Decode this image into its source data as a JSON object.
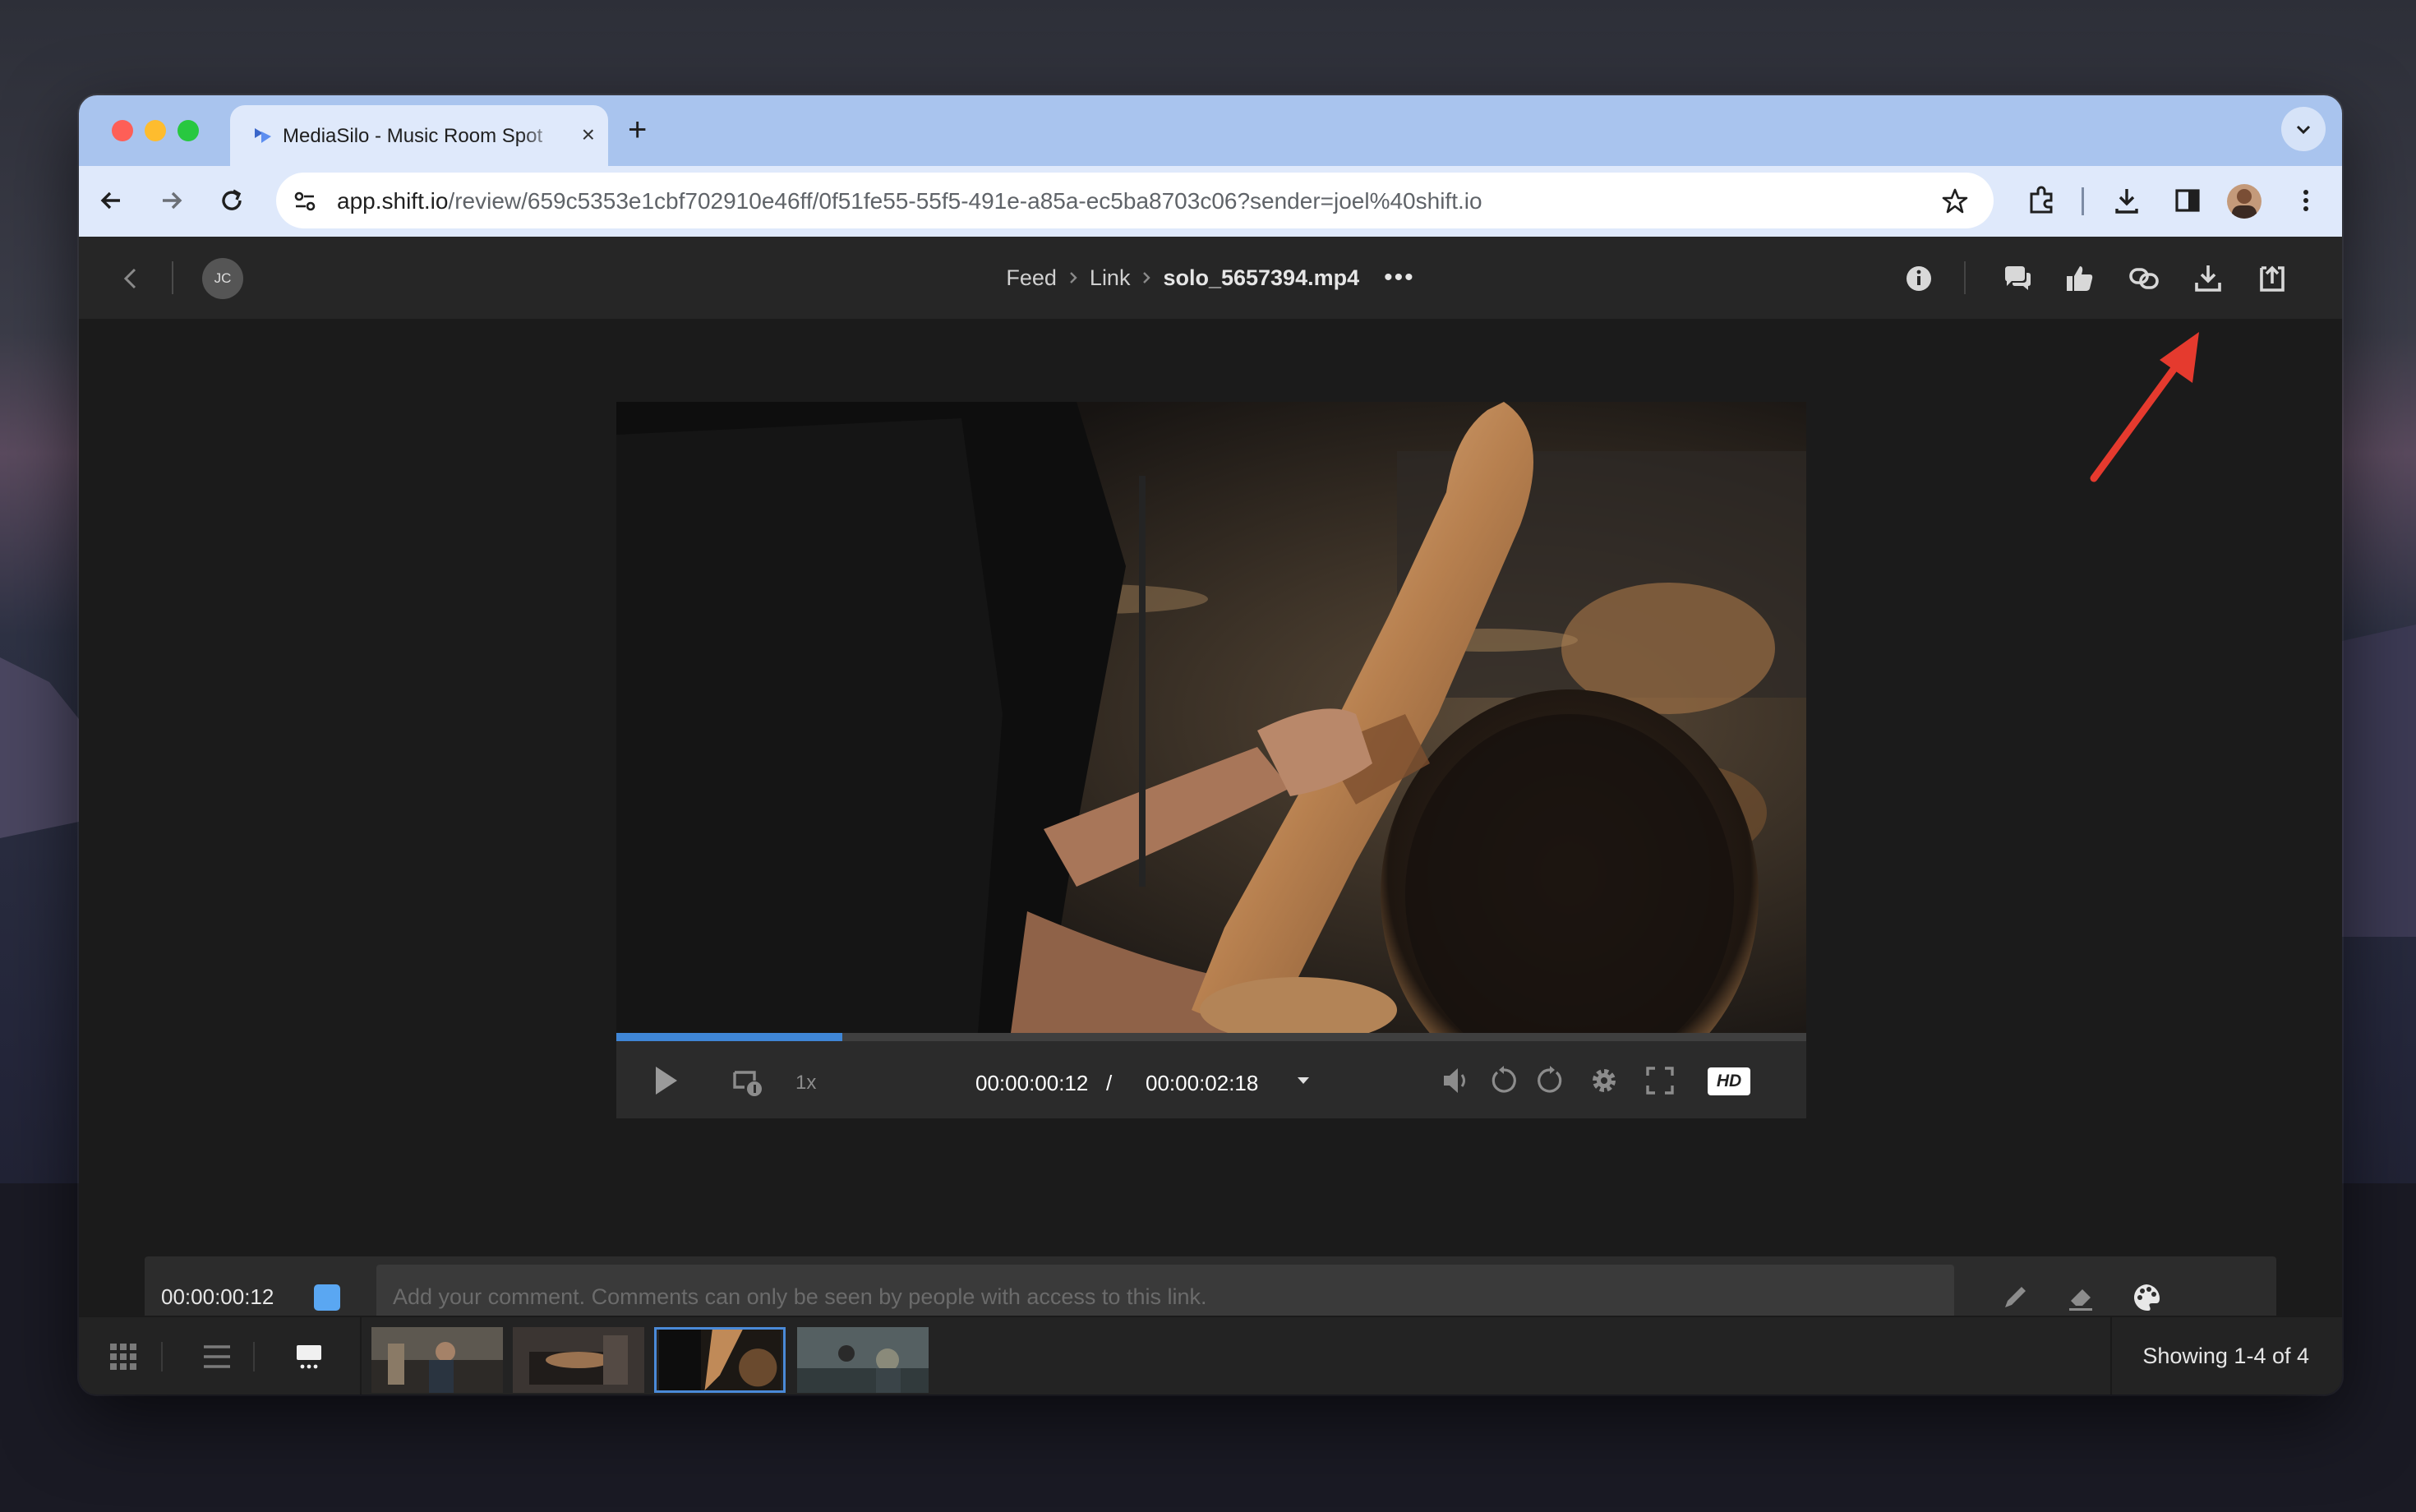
{
  "browser": {
    "tab_title": "MediaSilo - Music Room Spot",
    "new_tab": "+",
    "tab_close": "×",
    "url_domain": "app.shift.io",
    "url_path": "/review/659c5353e1cbf702910e46ff/0f51fe55-55f5-491e-a85a-ec5ba8703c06?sender=joel%40shift.io"
  },
  "header": {
    "avatar_initials": "JC",
    "breadcrumb": [
      "Feed",
      "Link",
      "solo_5657394.mp4"
    ],
    "more": "•••"
  },
  "player": {
    "progress": 0.19,
    "speed": "1x",
    "current_time": "00:00:00:12",
    "separator": "/",
    "duration": "00:00:02:18",
    "quality_badge": "HD"
  },
  "comment": {
    "timestamp": "00:00:00:12",
    "placeholder": "Add your comment. Comments can only be seen by people with access to this link."
  },
  "footer": {
    "showing": "Showing 1-4 of 4",
    "thumbnails": [
      "clip-1",
      "clip-2",
      "clip-3",
      "clip-4"
    ],
    "selected_thumbnail": 2
  },
  "colors": {
    "accent": "#3f86d6",
    "annotation_arrow": "#e53a2e",
    "browser_frame": "#a9c4ee",
    "app_bg": "#1b1b1b"
  },
  "icons": [
    "back-chevron-icon",
    "info-icon",
    "comments-icon",
    "thumbs-up-icon",
    "link-icon",
    "download-icon",
    "upload-icon",
    "play-icon",
    "loop-icon",
    "volume-icon",
    "rewind-icon",
    "forward-icon",
    "gear-icon",
    "fullscreen-icon",
    "pen-icon",
    "eraser-icon",
    "palette-icon",
    "grid-view-icon",
    "list-view-icon",
    "player-view-icon"
  ]
}
